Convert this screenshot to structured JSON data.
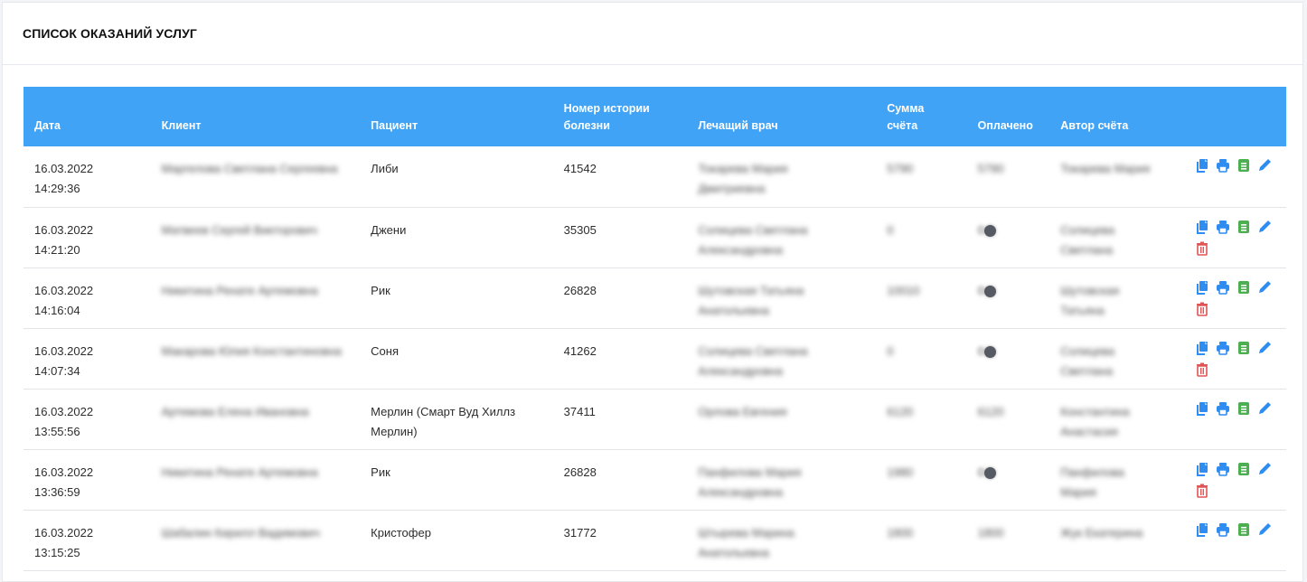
{
  "page": {
    "title": "СПИСОК ОКАЗАНИЙ УСЛУГ"
  },
  "table": {
    "headers": {
      "date": "Дата",
      "client": "Клиент",
      "patient": "Пациент",
      "history_number": "Номер истории болезни",
      "doctor": "Лечащий врач",
      "sum": "Сумма счёта",
      "paid": "Оплачено",
      "author": "Автор счёта"
    },
    "rows": [
      {
        "date": "16.03.2022",
        "time": "14:29:36",
        "client": "Маргелова Светлана Сергеевна",
        "patient": "Либи",
        "history": "41542",
        "doctor": "Токарева Мария Дмитриевна",
        "sum": "5790",
        "paid": "5790",
        "author": "Токарева Мария",
        "deletable": false,
        "paid_indicator": false
      },
      {
        "date": "16.03.2022",
        "time": "14:21:20",
        "client": "Матвеев Сергей Викторович",
        "patient": "Джени",
        "history": "35305",
        "doctor": "Солицева Светлана Александровна",
        "sum": "0",
        "paid": "0",
        "author": "Солицева Светлана",
        "deletable": true,
        "paid_indicator": true
      },
      {
        "date": "16.03.2022",
        "time": "14:16:04",
        "client": "Никитина Ренате Артемовна",
        "patient": "Рик",
        "history": "26828",
        "doctor": "Шутовская Татьяна Анатольевна",
        "sum": "10010",
        "paid": "0",
        "author": "Шутовская Татьяна",
        "deletable": true,
        "paid_indicator": true
      },
      {
        "date": "16.03.2022",
        "time": "14:07:34",
        "client": "Макарова Юлия Константиновна",
        "patient": "Соня",
        "history": "41262",
        "doctor": "Солицева Светлана Александровна",
        "sum": "0",
        "paid": "0",
        "author": "Солицева Светлана",
        "deletable": true,
        "paid_indicator": true
      },
      {
        "date": "16.03.2022",
        "time": "13:55:56",
        "client": "Артемова Елена Ивановна",
        "patient": "Мерлин (Смарт Вуд Хиллз Мерлин)",
        "history": "37411",
        "doctor": "Орлова Евгения",
        "sum": "6120",
        "paid": "6120",
        "author": "Константина Анастасия",
        "deletable": false,
        "paid_indicator": false
      },
      {
        "date": "16.03.2022",
        "time": "13:36:59",
        "client": "Никитина Ренате Артемовна",
        "patient": "Рик",
        "history": "26828",
        "doctor": "Панфилова Мария Александровна",
        "sum": "1980",
        "paid": "0",
        "author": "Панфилова Мария",
        "deletable": true,
        "paid_indicator": true
      },
      {
        "date": "16.03.2022",
        "time": "13:15:25",
        "client": "Шабалин Кирилл Вадимович",
        "patient": "Кристофер",
        "history": "31772",
        "doctor": "Штырева Марина Анатольевна",
        "sum": "1800",
        "paid": "1800",
        "author": "Жук Екатерина",
        "deletable": false,
        "paid_indicator": false
      }
    ]
  },
  "icons": {
    "copy": "copy-icon",
    "print": "print-icon",
    "invoice": "invoice-icon",
    "edit": "edit-icon",
    "delete": "trash-icon"
  },
  "colors": {
    "header_bg": "#41a3f5",
    "action_blue": "#2f8cf0",
    "action_green": "#4caf50",
    "action_red": "#e05555"
  }
}
